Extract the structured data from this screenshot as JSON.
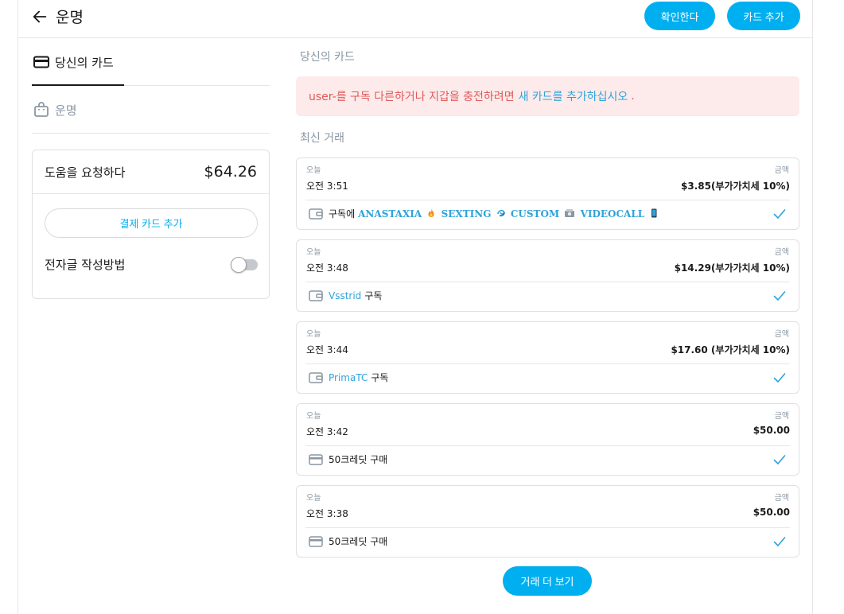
{
  "header": {
    "title": "운명",
    "confirm_label": "확인한다",
    "add_card_label": "카드 추가"
  },
  "sidebar": {
    "tabs": [
      {
        "label": "당신의 카드",
        "icon": "credit-card-icon",
        "active": true
      },
      {
        "label": "운명",
        "icon": "bag-icon",
        "active": false
      }
    ]
  },
  "wallet": {
    "label": "도움을 요청하다",
    "balance": "$64.26",
    "add_payment_label": "결제 카드 추가",
    "toggle_label": "전자글 작성방법",
    "toggle_on": false
  },
  "main": {
    "cards_title": "당신의 카드",
    "alert": {
      "text": "user-를 구독 다른하거나 지갑을 충전하려면",
      "link": "새 카드를 추가하십시오",
      "end": "."
    },
    "transactions_title": "최신 거래",
    "amount_label": "금액",
    "transactions": [
      {
        "day": "오늘",
        "time": "오전 3:51",
        "amount": "$3.85(부가가치세 10%)",
        "icon": "wallet-icon",
        "desc_prefix": "구독에",
        "name_parts": [
          "ANASTAXIA",
          "SEXTING",
          "CUSTOM",
          "VIDEOCALL"
        ],
        "emojis": [
          "fire-emoji",
          "dizzy-emoji",
          "camera-emoji",
          "phone-emoji"
        ]
      },
      {
        "day": "오늘",
        "time": "오전 3:48",
        "amount": "$14.29(부가가치세 10%)",
        "icon": "wallet-icon",
        "link": "Vsstrid",
        "desc_suffix": "구독"
      },
      {
        "day": "오늘",
        "time": "오전 3:44",
        "amount": "$17.60 (부가가치세 10%)",
        "icon": "wallet-icon",
        "link": "PrimaTC",
        "desc_suffix": "구독"
      },
      {
        "day": "오늘",
        "time": "오전 3:42",
        "amount": "$50.00",
        "icon": "credit-card-icon",
        "desc": "50크레딧 구매"
      },
      {
        "day": "오늘",
        "time": "오전 3:38",
        "amount": "$50.00",
        "icon": "credit-card-icon",
        "desc": "50크레딧 구매"
      }
    ],
    "more_label": "거래 더 보기"
  },
  "colors": {
    "accent": "#00aff0",
    "link": "#2fa3d9",
    "alert_bg": "#fdeaea",
    "alert_text": "#e05a5a",
    "muted": "#8a96a3"
  }
}
